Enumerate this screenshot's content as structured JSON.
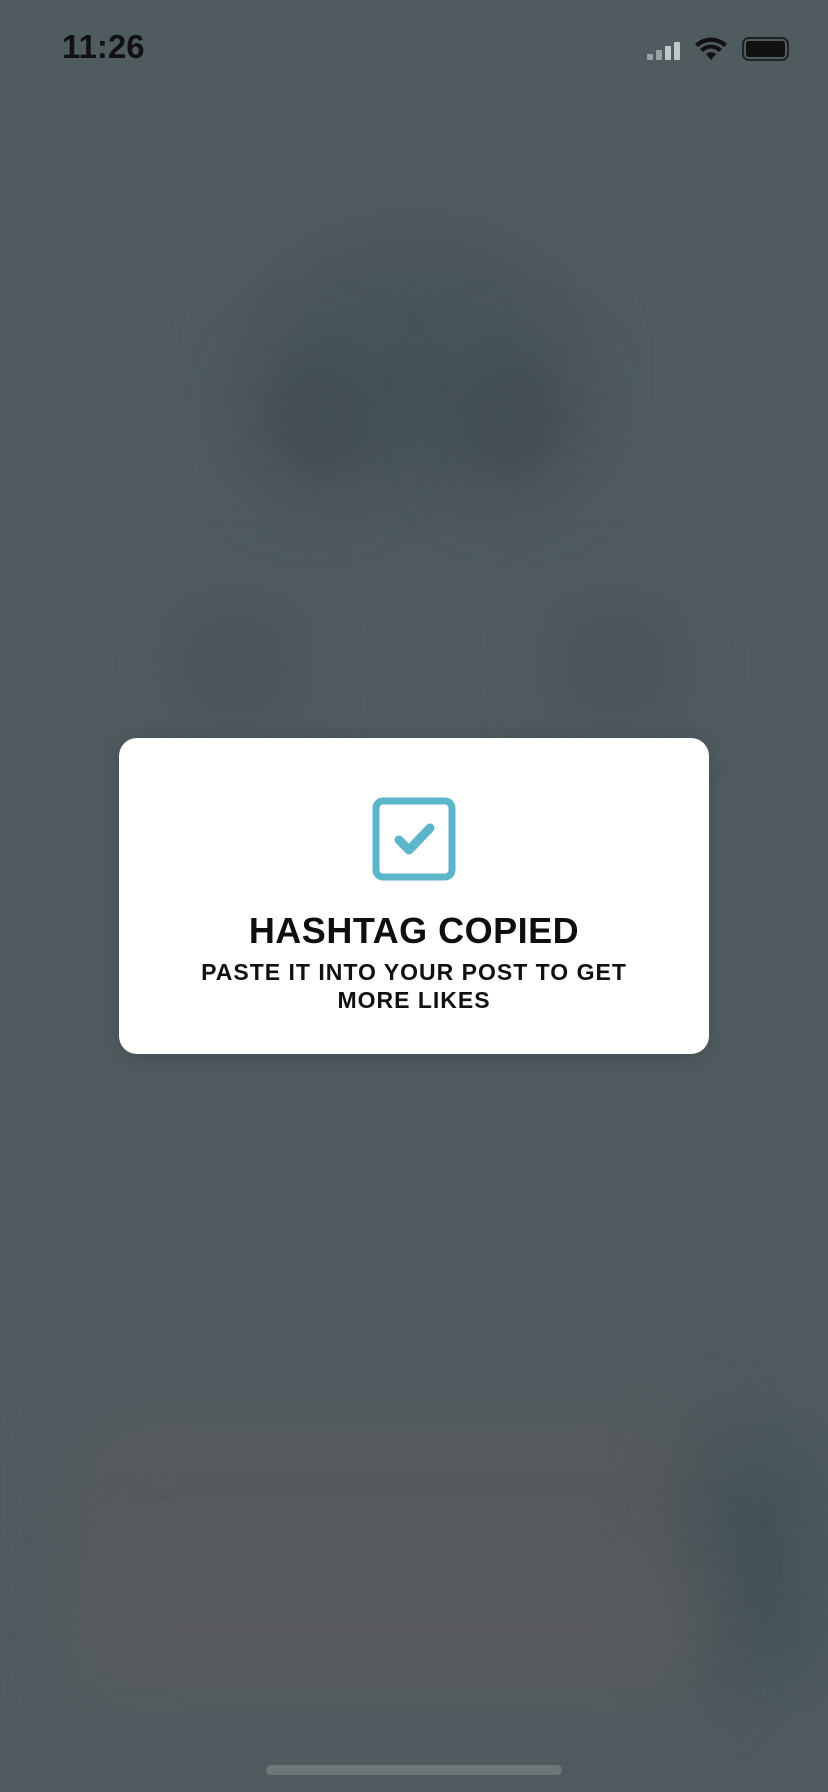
{
  "status_bar": {
    "time": "11:26",
    "icons": [
      "cellular-signal-icon",
      "wifi-icon",
      "battery-icon"
    ]
  },
  "toast": {
    "icon": "checkbox-checked-icon",
    "accent_color": "#5bb6cc",
    "title": "HASHTAG COPIED",
    "subtitle": "PASTE IT INTO YOUR POST TO GET MORE LIKES"
  }
}
